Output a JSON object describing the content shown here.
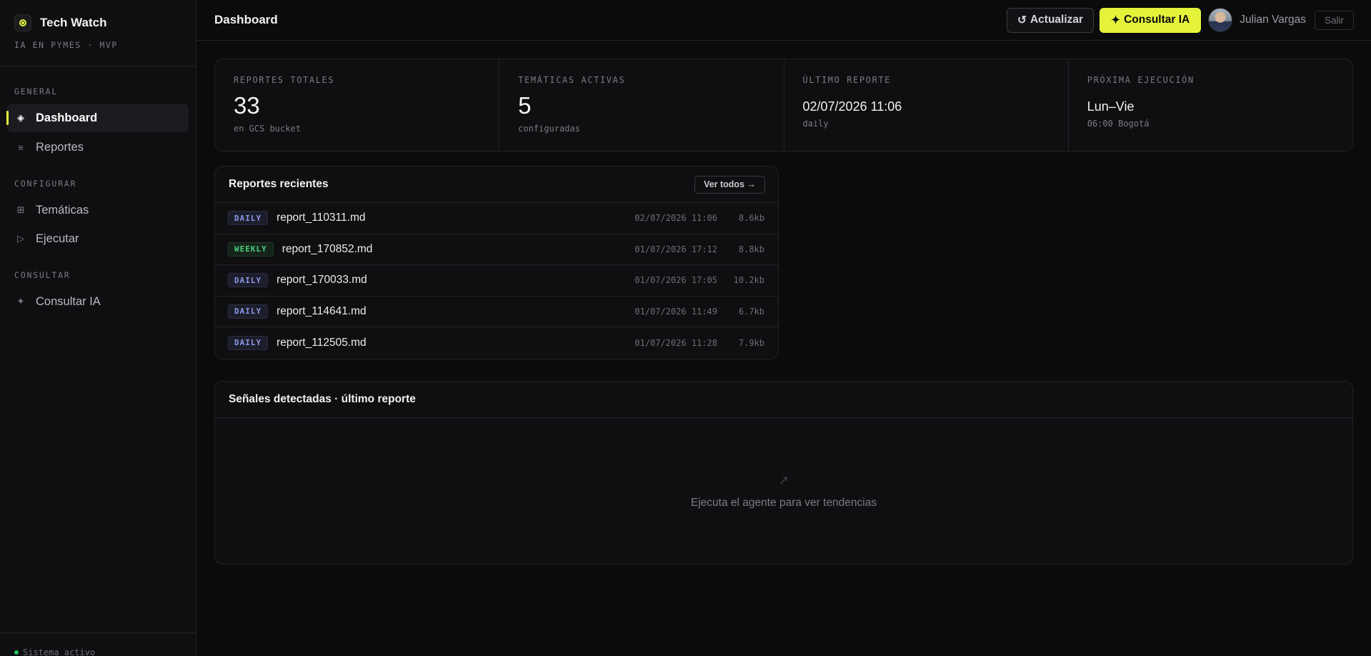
{
  "sidebar": {
    "brand_title": "Tech Watch",
    "brand_subtitle": "IA EN PYMES · MVP",
    "sections": {
      "general": "GENERAL",
      "configurar": "CONFIGURAR",
      "consultar": "CONSULTAR"
    },
    "items": {
      "dashboard": "Dashboard",
      "reportes": "Reportes",
      "tematicas": "Temáticas",
      "ejecutar": "Ejecutar",
      "consultar_ia": "Consultar IA"
    },
    "footer_status": "Sistema activo"
  },
  "topbar": {
    "title": "Dashboard",
    "refresh_label": "Actualizar",
    "ask_label": "Consultar IA",
    "user_name": "Julian Vargas",
    "logout_label": "Salir"
  },
  "stats": [
    {
      "label": "REPORTES TOTALES",
      "value": "33",
      "sub": "en GCS bucket"
    },
    {
      "label": "TEMÁTICAS ACTIVAS",
      "value": "5",
      "sub": "configuradas"
    },
    {
      "label": "ÚLTIMO REPORTE",
      "value": "02/07/2026 11:06",
      "sub": "daily"
    },
    {
      "label": "PRÓXIMA EJECUCIÓN",
      "value": "Lun–Vie",
      "sub": "06:00 Bogotá"
    }
  ],
  "recent": {
    "title": "Reportes recientes",
    "view_all_label": "Ver todos →",
    "rows": [
      {
        "type": "DAILY",
        "name": "report_110311.md",
        "date": "02/07/2026 11:06",
        "size": "8.6kb"
      },
      {
        "type": "WEEKLY",
        "name": "report_170852.md",
        "date": "01/07/2026 17:12",
        "size": "8.8kb"
      },
      {
        "type": "DAILY",
        "name": "report_170033.md",
        "date": "01/07/2026 17:05",
        "size": "10.2kb"
      },
      {
        "type": "DAILY",
        "name": "report_114641.md",
        "date": "01/07/2026 11:49",
        "size": "6.7kb"
      },
      {
        "type": "DAILY",
        "name": "report_112505.md",
        "date": "01/07/2026 11:28",
        "size": "7.9kb"
      }
    ]
  },
  "signals": {
    "title": "Señales detectadas · último reporte",
    "empty_text": "Ejecuta el agente para ver tendencias"
  },
  "icons": {
    "brand": "target-icon",
    "dashboard": "diamond-icon",
    "reportes": "list-icon",
    "tematicas": "grid-icon",
    "ejecutar": "play-icon",
    "consultar_ia": "sparkle-icon",
    "refresh": "refresh-icon",
    "trend": "trend-arrow-icon"
  },
  "colors": {
    "accent": "#e4f23a",
    "background": "#0b0b0c",
    "daily_badge": "#8d97e6",
    "weekly_badge": "#4cd07a",
    "status_ok": "#22c55e"
  }
}
